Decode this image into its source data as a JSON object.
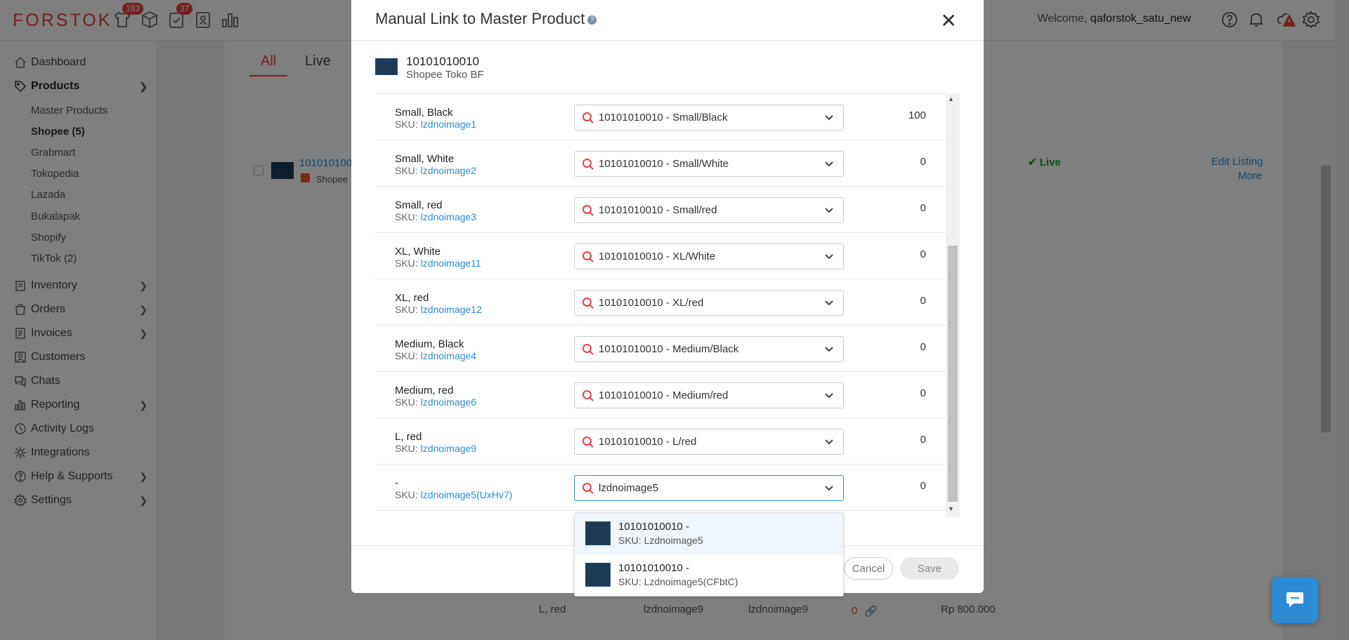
{
  "app": {
    "logo": "FORSTOK"
  },
  "topbar": {
    "badge_products": "183",
    "badge_orders": "37",
    "welcome_prefix": "Welcome,",
    "username": "qaforstok_satu_new"
  },
  "sidebar": {
    "dashboard": "Dashboard",
    "products": "Products",
    "sub": [
      "Master Products",
      "Shopee (5)",
      "Grabmart",
      "Tokopedia",
      "Lazada",
      "Bukalapak",
      "Shopify",
      "TikTok (2)"
    ],
    "inventory": "Inventory",
    "orders": "Orders",
    "invoices": "Invoices",
    "customers": "Customers",
    "chats": "Chats",
    "reporting": "Reporting",
    "activity_logs": "Activity Logs",
    "integrations": "Integrations",
    "help": "Help & Supports",
    "settings": "Settings"
  },
  "background": {
    "tab_all": "All",
    "tab_live": "Live",
    "product_code": "101010100",
    "store": "Shopee",
    "status_live": "Live",
    "edit_listing": "Edit Listing",
    "more": "More",
    "row_variant": "L, red",
    "row_sku1": "lzdnoimage9",
    "row_sku2": "lzdnoimage9",
    "row_qty": "0",
    "row_price": "Rp 800.000",
    "partial_price": ".000",
    "partial_top": "0"
  },
  "modal": {
    "title": "Manual Link to Master Product",
    "product_name": "10101010010",
    "store": "Shopee Toko BF",
    "rows": [
      {
        "name": "Small, Black",
        "sku_label": "SKU:",
        "sku": "lzdnoimage1",
        "value": "10101010010 - Small/Black",
        "qty": "100"
      },
      {
        "name": "Small, White",
        "sku_label": "SKU:",
        "sku": "lzdnoimage2",
        "value": "10101010010 - Small/White",
        "qty": "0"
      },
      {
        "name": "Small, red",
        "sku_label": "SKU:",
        "sku": "lzdnoimage3",
        "value": "10101010010 - Small/red",
        "qty": "0"
      },
      {
        "name": "XL, White",
        "sku_label": "SKU:",
        "sku": "lzdnoimage11",
        "value": "10101010010 - XL/White",
        "qty": "0"
      },
      {
        "name": "XL, red",
        "sku_label": "SKU:",
        "sku": "lzdnoimage12",
        "value": "10101010010 - XL/red",
        "qty": "0"
      },
      {
        "name": "Medium, Black",
        "sku_label": "SKU:",
        "sku": "lzdnoimage4",
        "value": "10101010010 - Medium/Black",
        "qty": "0"
      },
      {
        "name": "Medium, red",
        "sku_label": "SKU:",
        "sku": "lzdnoimage6",
        "value": "10101010010 - Medium/red",
        "qty": "0"
      },
      {
        "name": "L, red",
        "sku_label": "SKU:",
        "sku": "lzdnoimage9",
        "value": "10101010010 - L/red",
        "qty": "0"
      },
      {
        "name": "-",
        "sku_label": "SKU:",
        "sku": "lzdnoimage5(UxHv7)",
        "value": "lzdnoimage5",
        "qty": "0"
      }
    ],
    "cancel": "Cancel",
    "save": "Save"
  },
  "dropdown": {
    "options": [
      {
        "name": "10101010010 -",
        "sku": "SKU: Lzdnoimage5"
      },
      {
        "name": "10101010010 -",
        "sku": "SKU: Lzdnoimage5(CFbtC)"
      }
    ]
  },
  "colors": {
    "brand": "#e8413d",
    "link": "#2d8bd4",
    "live": "#1f9d3a"
  }
}
